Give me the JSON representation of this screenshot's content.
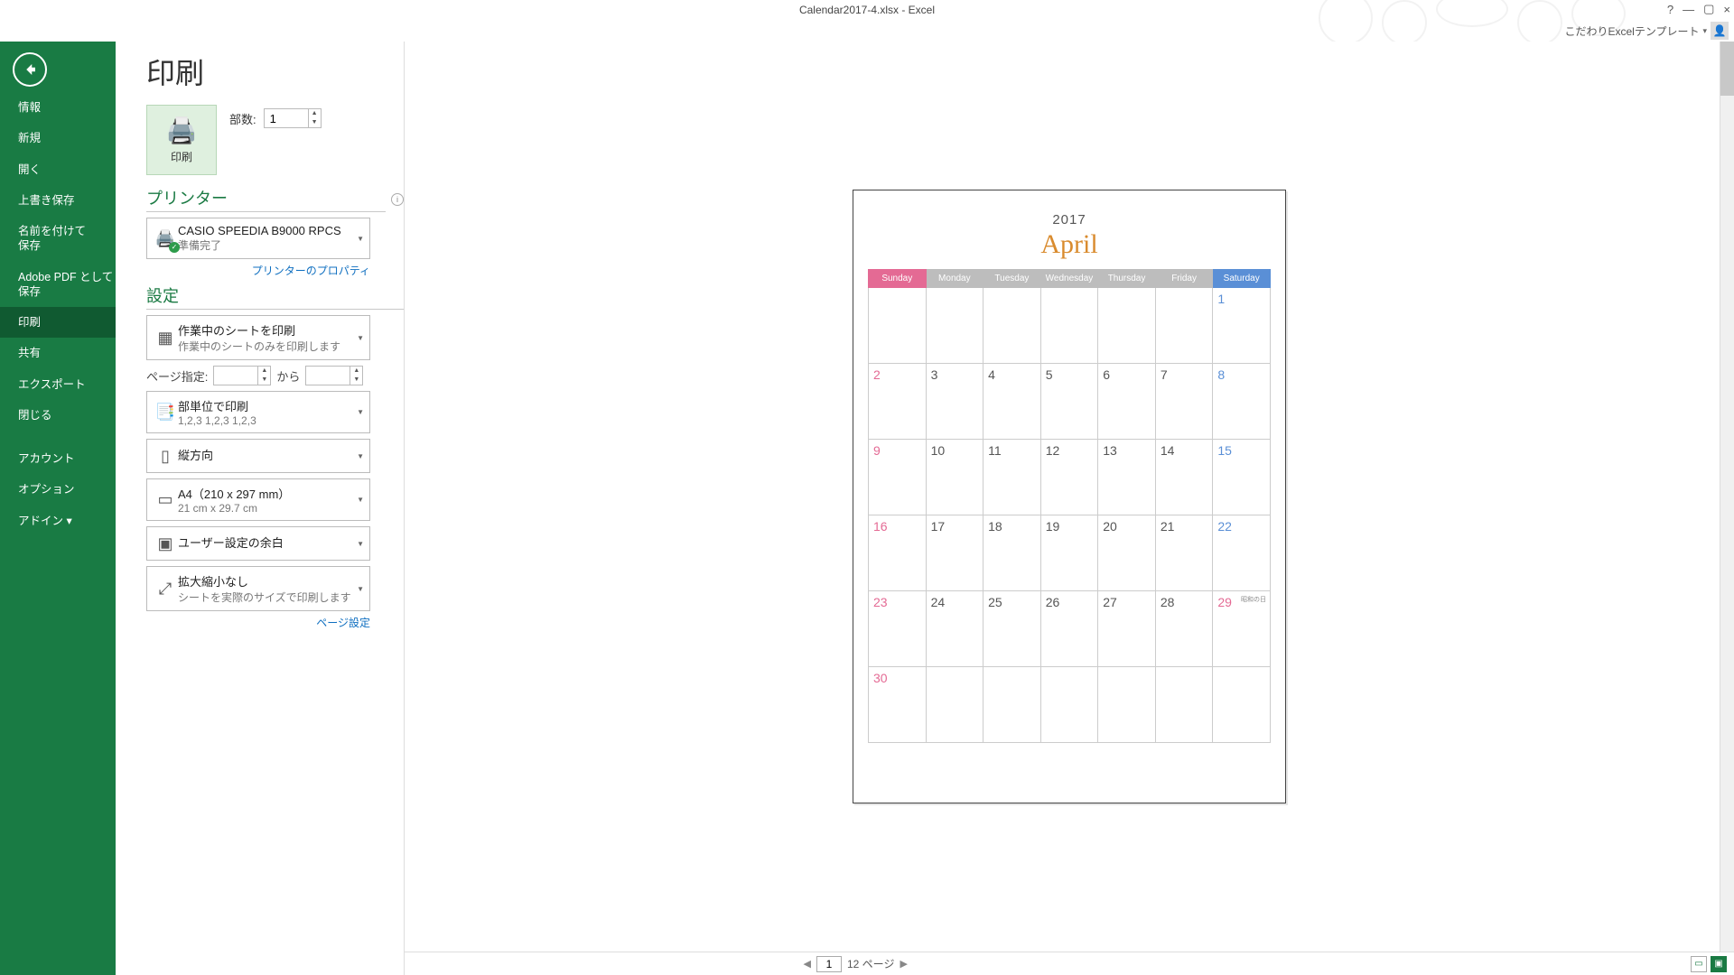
{
  "titlebar": {
    "title": "Calendar2017-4.xlsx - Excel"
  },
  "window_controls": {
    "help": "?",
    "min": "—",
    "max": "▢",
    "close": "×"
  },
  "userbar": {
    "label": "こだわりExcelテンプレート"
  },
  "nav": {
    "items": [
      "情報",
      "新規",
      "開く",
      "上書き保存",
      "名前を付けて\n保存",
      "Adobe PDF として\n保存",
      "印刷",
      "共有",
      "エクスポート",
      "閉じる"
    ],
    "items2": [
      "アカウント",
      "オプション",
      "アドイン ▾"
    ],
    "active": "印刷"
  },
  "page": {
    "title": "印刷"
  },
  "print_button": {
    "label": "印刷"
  },
  "copies": {
    "label": "部数:",
    "value": "1"
  },
  "printer_section": {
    "title": "プリンター"
  },
  "printer": {
    "name": "CASIO SPEEDIA B9000 RPCS",
    "status": "準備完了"
  },
  "printer_props_link": "プリンターのプロパティ",
  "settings_section": {
    "title": "設定"
  },
  "settings": {
    "what": {
      "t1": "作業中のシートを印刷",
      "t2": "作業中のシートのみを印刷します"
    },
    "pages": {
      "label": "ページ指定:",
      "to": "から"
    },
    "collate": {
      "t1": "部単位で印刷",
      "t2": "1,2,3    1,2,3    1,2,3"
    },
    "orient": {
      "t1": "縦方向"
    },
    "paper": {
      "t1": "A4（210 x 297 mm）",
      "t2": "21 cm x 29.7 cm"
    },
    "margin": {
      "t1": "ユーザー設定の余白"
    },
    "scale": {
      "t1": "拡大縮小なし",
      "t2": "シートを実際のサイズで印刷します"
    },
    "page_setup_link": "ページ設定"
  },
  "preview": {
    "year": "2017",
    "month": "April",
    "weekdays": [
      "Sunday",
      "Monday",
      "Tuesday",
      "Wednesday",
      "Thursday",
      "Friday",
      "Saturday"
    ],
    "weeks": [
      [
        "",
        "",
        "",
        "",
        "",
        "",
        "1"
      ],
      [
        "2",
        "3",
        "4",
        "5",
        "6",
        "7",
        "8"
      ],
      [
        "9",
        "10",
        "11",
        "12",
        "13",
        "14",
        "15"
      ],
      [
        "16",
        "17",
        "18",
        "19",
        "20",
        "21",
        "22"
      ],
      [
        "23",
        "24",
        "25",
        "26",
        "27",
        "28",
        "29"
      ],
      [
        "30",
        "",
        "",
        "",
        "",
        "",
        ""
      ]
    ],
    "holiday": {
      "row": 4,
      "col": 6,
      "text": "昭和の日"
    }
  },
  "footer": {
    "page": "1",
    "total": "12 ページ"
  }
}
